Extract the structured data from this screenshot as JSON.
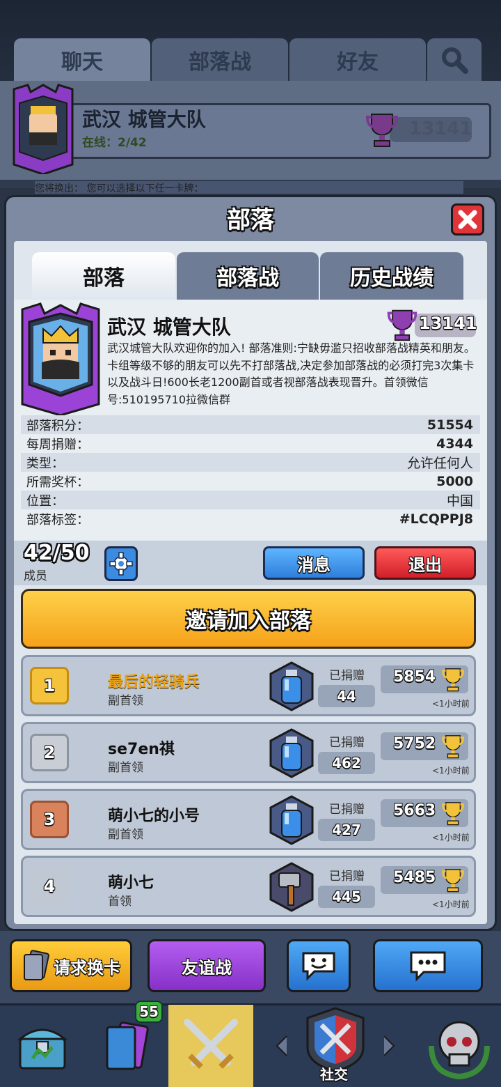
{
  "top_tabs": {
    "chat": "聊天",
    "clan_war": "部落战",
    "friends": "好友"
  },
  "top_clan": {
    "name": "武汉 城管大队",
    "online": "在线：2/42",
    "trophies": "13141"
  },
  "top_strip_text": "您将换出：                          您可以选择以下任一卡牌：",
  "modal": {
    "title": "部落",
    "tabs": [
      "部落",
      "部落战",
      "历史战绩"
    ],
    "clan": {
      "name": "武汉 城管大队",
      "trophies": "13141",
      "description": "武汉城管大队欢迎你的加入! 部落准则:宁缺毋滥只招收部落战精英和朋友。卡组等级不够的朋友可以先不打部落战,决定参加部落战的必须打完3次集卡以及战斗日!600长老1200副首或者视部落战表现晋升。首领微信号:510195710拉微信群"
    },
    "stats": [
      {
        "label": "部落积分：",
        "value": "51554"
      },
      {
        "label": "每周捐赠：",
        "value": "4344"
      },
      {
        "label": "类型：",
        "value": "允许任何人"
      },
      {
        "label": "所需奖杯：",
        "value": "5000"
      },
      {
        "label": "位置：",
        "value": "中国"
      },
      {
        "label": "部落标签：",
        "value": "#LCQPPJ8"
      }
    ],
    "members_count": "42/50",
    "members_label": "成员",
    "message_button": "消息",
    "leave_button": "退出",
    "invite_button": "邀请加入部落",
    "donated_label": "已捐赠",
    "members": [
      {
        "rank": "1",
        "name": "最后的轻骑兵",
        "role": "副首领",
        "donated": "44",
        "trophies": "5854",
        "last_seen": "<1小时前"
      },
      {
        "rank": "2",
        "name": "se7en祺",
        "role": "副首领",
        "donated": "462",
        "trophies": "5752",
        "last_seen": "<1小时前"
      },
      {
        "rank": "3",
        "name": "萌小七的小号",
        "role": "副首领",
        "donated": "427",
        "trophies": "5663",
        "last_seen": "<1小时前"
      },
      {
        "rank": "4",
        "name": "萌小七",
        "role": "首领",
        "donated": "445",
        "trophies": "5485",
        "last_seen": "<1小时前"
      }
    ]
  },
  "actions": {
    "request_card": "请求换卡",
    "friendly_battle": "友谊战"
  },
  "nav": {
    "cards_badge": "55",
    "social_label": "社交"
  },
  "colors": {
    "rank1": "#f5c33b",
    "rank2": "#c9ced6",
    "rank3": "#d9835c",
    "rank4": "#c0c8d4",
    "invite": "#f5a21a",
    "leave": "#d21f2a",
    "message": "#2f7fdb"
  }
}
